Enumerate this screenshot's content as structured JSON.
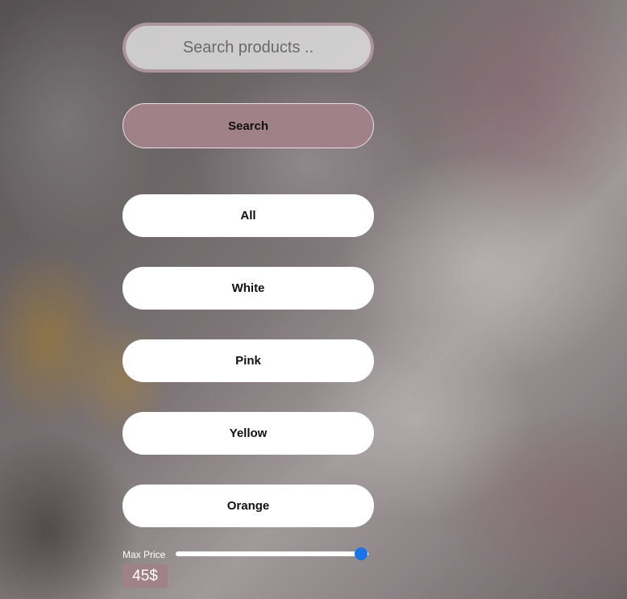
{
  "search": {
    "placeholder": "Search products ..",
    "value": "",
    "button_label": "Search"
  },
  "filters": {
    "items": [
      {
        "label": "All"
      },
      {
        "label": "White"
      },
      {
        "label": "Pink"
      },
      {
        "label": "Yellow"
      },
      {
        "label": "Orange"
      }
    ]
  },
  "price": {
    "label": "Max Price",
    "value_text": "45$",
    "slider_fraction": 0.96
  },
  "colors": {
    "accent": "#a08089",
    "slider_thumb": "#1a73e8",
    "button_bg": "#ffffff"
  }
}
